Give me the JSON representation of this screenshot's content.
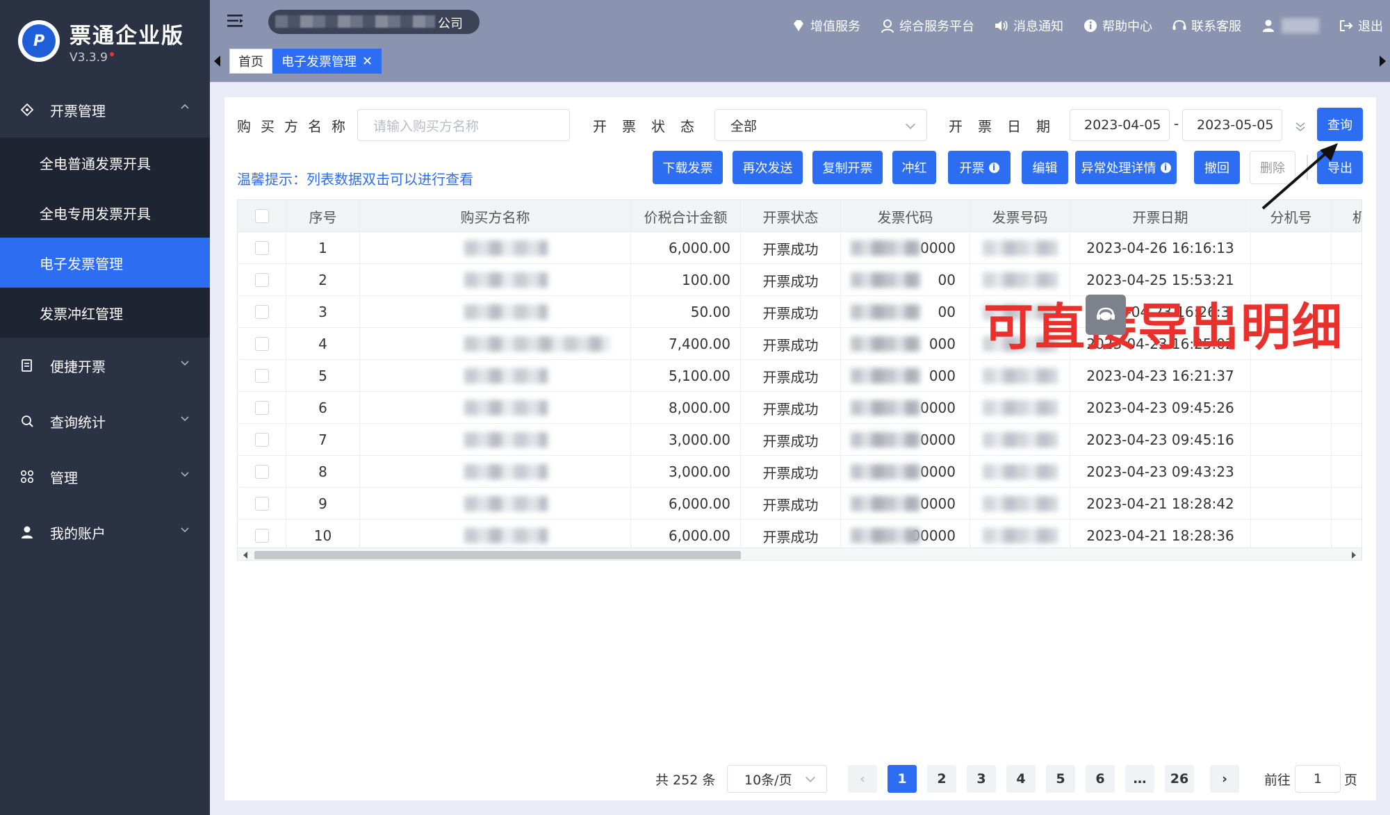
{
  "app": {
    "title": "票通企业版",
    "version": "V3.3.9"
  },
  "sidebar": {
    "groups": [
      {
        "label": "开票管理",
        "icon": "ticket-diamond-icon",
        "expanded": true
      },
      {
        "label": "便捷开票",
        "icon": "receipt-icon",
        "expanded": false
      },
      {
        "label": "查询统计",
        "icon": "search-chart-icon",
        "expanded": false
      },
      {
        "label": "管理",
        "icon": "grid-icon",
        "expanded": false
      },
      {
        "label": "我的账户",
        "icon": "user-icon",
        "expanded": false
      }
    ],
    "submenu": [
      "全电普通发票开具",
      "全电专用发票开具",
      "电子发票管理",
      "发票冲红管理"
    ],
    "active_submenu": "电子发票管理"
  },
  "topbar": {
    "company_suffix": "公司",
    "links": [
      "增值服务",
      "综合服务平台",
      "消息通知",
      "帮助中心",
      "联系客服",
      "退出"
    ],
    "tabs": {
      "home": "首页",
      "current": "电子发票管理"
    }
  },
  "filters": {
    "buyer_label": "购买方名称",
    "buyer_placeholder": "请输入购买方名称",
    "status_label": "开票状态",
    "status_value": "全部",
    "date_label": "开票日期",
    "date_start": "2023-04-05",
    "date_sep": "-",
    "date_end": "2023-05-05",
    "query_button": "查询"
  },
  "tip": "温馨提示：列表数据双击可以进行查看",
  "actions": [
    "下载发票",
    "再次发送",
    "复制开票",
    "冲红",
    "开票",
    "编辑",
    "异常处理详情",
    "撤回",
    "删除",
    "导出"
  ],
  "table": {
    "headers": [
      "序号",
      "购买方名称",
      "价税合计金额",
      "开票状态",
      "发票代码",
      "发票号码",
      "开票日期",
      "分机号",
      "机器编号"
    ],
    "rows": [
      {
        "no": "1",
        "amount": "6,000.00",
        "status": "开票成功",
        "code_tail": "0000",
        "date": "2023-04-26 16:16:13"
      },
      {
        "no": "2",
        "amount": "100.00",
        "status": "开票成功",
        "code_tail": "00",
        "date": "2023-04-25 15:53:21"
      },
      {
        "no": "3",
        "amount": "50.00",
        "status": "开票成功",
        "code_tail": "00",
        "date": "2023-04-23 16:26:3"
      },
      {
        "no": "4",
        "amount": "7,400.00",
        "status": "开票成功",
        "code_tail": "000",
        "date": "2023-04-23 16:25:02"
      },
      {
        "no": "5",
        "amount": "5,100.00",
        "status": "开票成功",
        "code_tail": "000",
        "date": "2023-04-23 16:21:37"
      },
      {
        "no": "6",
        "amount": "8,000.00",
        "status": "开票成功",
        "code_tail": "0000",
        "date": "2023-04-23 09:45:26"
      },
      {
        "no": "7",
        "amount": "3,000.00",
        "status": "开票成功",
        "code_tail": "0000",
        "date": "2023-04-23 09:45:16"
      },
      {
        "no": "8",
        "amount": "3,000.00",
        "status": "开票成功",
        "code_tail": "0000",
        "date": "2023-04-23 09:43:23"
      },
      {
        "no": "9",
        "amount": "6,000.00",
        "status": "开票成功",
        "code_tail": "0000",
        "date": "2023-04-21 18:28:42"
      },
      {
        "no": "10",
        "amount": "6,000.00",
        "status": "开票成功",
        "code_tail": "00000",
        "date": "2023-04-21 18:28:36"
      }
    ]
  },
  "annotation": "可直接导出明细",
  "pagination": {
    "total": "共 252 条",
    "page_size": "10条/页",
    "pages": [
      "1",
      "2",
      "3",
      "4",
      "5",
      "6",
      "…",
      "26"
    ],
    "current": "1",
    "goto_label": "前往",
    "goto_value": "1",
    "goto_suffix": "页"
  },
  "colors": {
    "sidebar_bg": "#2b3244",
    "submenu_bg": "#1f2432",
    "accent": "#2d6df2",
    "topbar_bg": "#8a93af",
    "annotation_red": "#e8312d"
  }
}
